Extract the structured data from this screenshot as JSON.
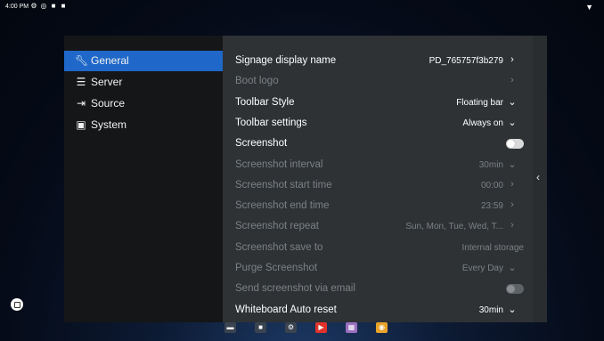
{
  "status_bar": {
    "time": "4:00 PM"
  },
  "nav": {
    "items": [
      {
        "label": "General",
        "icon": "wrench-icon",
        "active": true
      },
      {
        "label": "Server",
        "icon": "server-icon",
        "active": false
      },
      {
        "label": "Source",
        "icon": "source-icon",
        "active": false
      },
      {
        "label": "System",
        "icon": "system-icon",
        "active": false
      }
    ]
  },
  "settings": {
    "rows": [
      {
        "label": "Signage display name",
        "value": "PD_765757f3b279",
        "control": "chevron-right",
        "enabled": true
      },
      {
        "label": "Boot logo",
        "value": "",
        "control": "chevron-right",
        "enabled": false
      },
      {
        "label": "Toolbar Style",
        "value": "Floating bar",
        "control": "chevron-down",
        "enabled": true
      },
      {
        "label": "Toolbar settings",
        "value": "Always on",
        "control": "chevron-down",
        "enabled": true
      },
      {
        "label": "Screenshot",
        "value": "",
        "control": "toggle",
        "enabled": true,
        "toggle_on": false
      },
      {
        "label": "Screenshot interval",
        "value": "30min",
        "control": "chevron-down",
        "enabled": false
      },
      {
        "label": "Screenshot start time",
        "value": "00:00",
        "control": "chevron-right",
        "enabled": false
      },
      {
        "label": "Screenshot end time",
        "value": "23:59",
        "control": "chevron-right",
        "enabled": false
      },
      {
        "label": "Screenshot repeat",
        "value": "Sun, Mon, Tue, Wed, T...",
        "control": "chevron-right",
        "enabled": false
      },
      {
        "label": "Screenshot save to",
        "value": "Internal storage",
        "control": "none",
        "enabled": false
      },
      {
        "label": "Purge Screenshot",
        "value": "Every Day",
        "control": "chevron-down",
        "enabled": false
      },
      {
        "label": "Send screenshot via email",
        "value": "",
        "control": "toggle",
        "enabled": false,
        "toggle_on": false
      },
      {
        "label": "Whiteboard Auto reset",
        "value": "30min",
        "control": "chevron-down",
        "enabled": true
      }
    ]
  },
  "colors": {
    "active_nav": "#1f68c9",
    "left_panel": "#141618",
    "right_panel": "#2e3235",
    "dim_text": "#7c8185"
  }
}
